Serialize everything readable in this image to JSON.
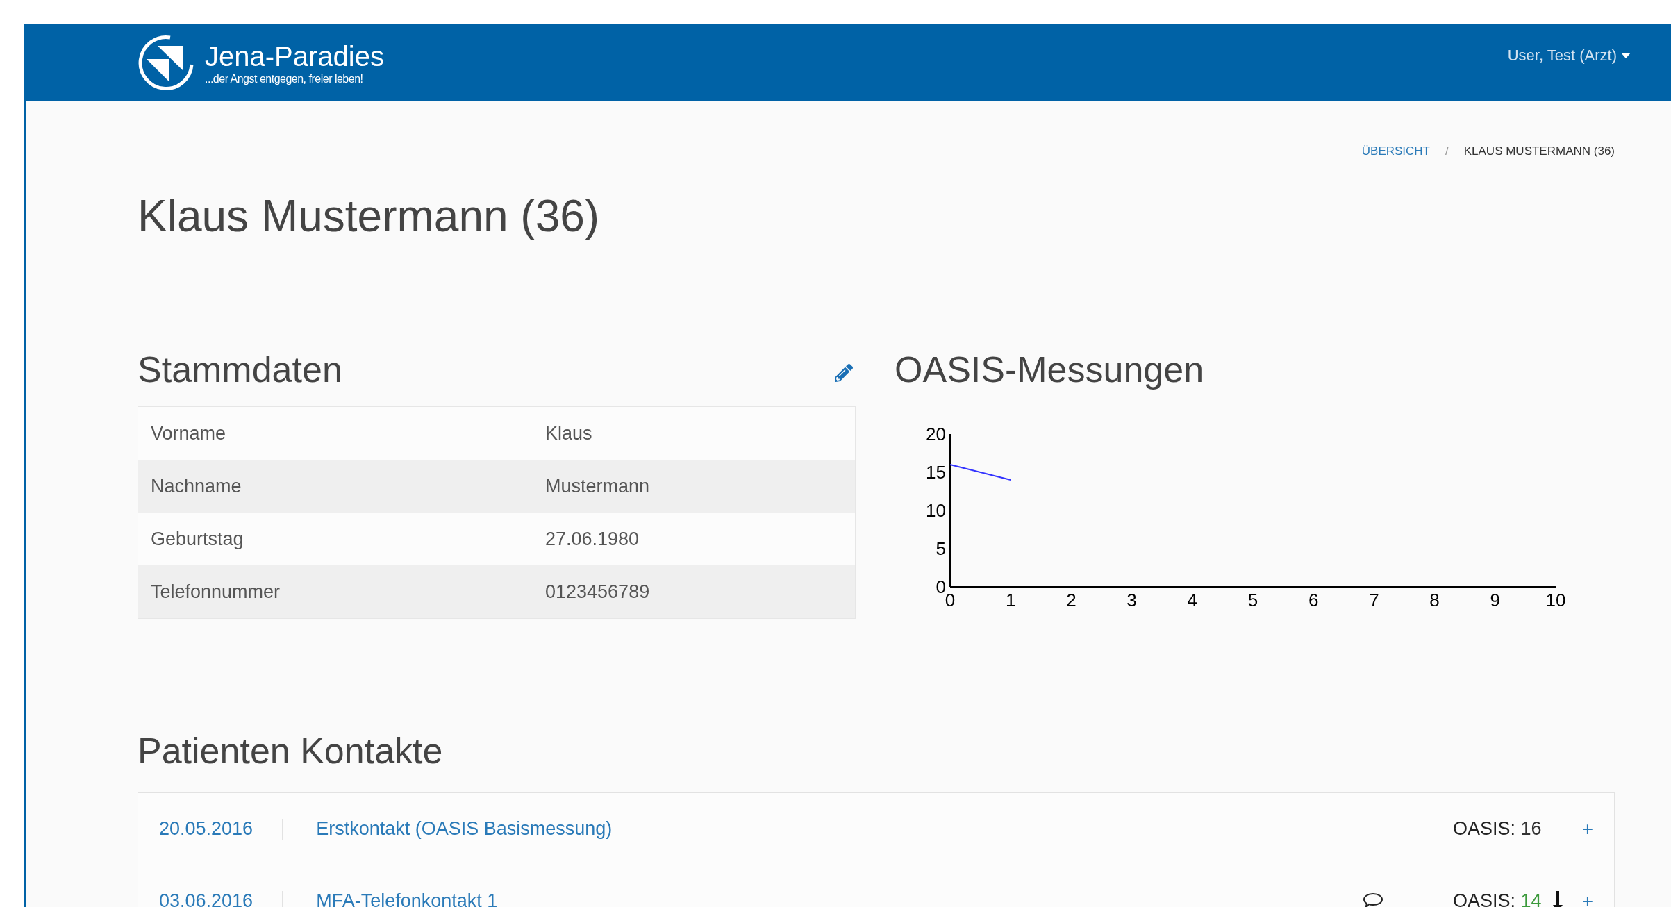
{
  "header": {
    "brand": "Jena-Paradies",
    "tagline": "...der Angst entgegen, freier leben!",
    "user_menu": "User, Test (Arzt)"
  },
  "breadcrumb": [
    {
      "label": "ÜBERSICHT",
      "kind": "link"
    },
    {
      "label": "KLAUS MUSTERMANN (36)",
      "kind": "current",
      "separator": "/"
    }
  ],
  "page_title": "Klaus Mustermann (36)",
  "stammdaten": {
    "title": "Stammdaten",
    "rows": [
      {
        "label": "Vorname",
        "value": "Klaus"
      },
      {
        "label": "Nachname",
        "value": "Mustermann"
      },
      {
        "label": "Geburtstag",
        "value": "27.06.1980"
      },
      {
        "label": "Telefonnummer",
        "value": "0123456789"
      }
    ]
  },
  "oasis": {
    "title": "OASIS-Messungen",
    "chart_data": {
      "type": "line",
      "x": [
        0,
        1
      ],
      "series": [
        {
          "color": "#3333ff",
          "values": [
            16,
            14
          ]
        }
      ],
      "xlim": [
        0,
        10
      ],
      "ylim": [
        0,
        20
      ],
      "xticks": [
        0,
        1,
        2,
        3,
        4,
        5,
        6,
        7,
        8,
        9,
        10
      ],
      "yticks": [
        0,
        5,
        10,
        15,
        20
      ]
    }
  },
  "kontakte": {
    "title": "Patienten Kontakte",
    "rows": [
      {
        "date": "20.05.2016",
        "title": "Erstkontakt (OASIS Basismessung)",
        "has_comment": false,
        "oasis_label": "OASIS:",
        "oasis_value": "16",
        "color": "#333333",
        "trend_down": false,
        "action": "+"
      },
      {
        "date": "03.06.2016",
        "title": "MFA-Telefonkontakt 1",
        "has_comment": true,
        "oasis_label": "OASIS:",
        "oasis_value": "14",
        "color": "#3c9a3c",
        "trend_down": true,
        "action": "+"
      }
    ]
  }
}
